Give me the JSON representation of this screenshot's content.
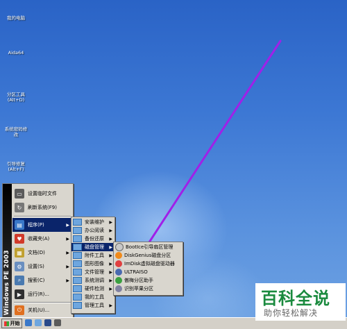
{
  "desktop": {
    "icons": [
      {
        "label": "我的电脑",
        "name": "my-computer-icon"
      },
      {
        "label": "Aida64",
        "name": "aida64-icon"
      },
      {
        "label": "分区工具\n(Alt+D)",
        "name": "partition-tool-icon"
      },
      {
        "label": "系统密码修\n改",
        "name": "password-tool-icon"
      },
      {
        "label": "引导修复\n(Alt+F)",
        "name": "boot-repair-icon"
      }
    ]
  },
  "start_menu": {
    "brand": "Windows PE 2003",
    "items": [
      {
        "label": "设置临时文件",
        "icon": "disk-icon",
        "color": "#5b5b5b"
      },
      {
        "label": "刷新系统(F9)",
        "icon": "refresh-icon",
        "color": "#777777"
      },
      {
        "label": "程序(P)",
        "icon": "folder-icon",
        "color": "#3a78c9",
        "arrow": "▶"
      },
      {
        "label": "收藏夹(A)",
        "icon": "heart-icon",
        "color": "#d23a2a",
        "arrow": "▶"
      },
      {
        "label": "文档(D)",
        "icon": "document-icon",
        "color": "#c0a030",
        "arrow": "▶"
      },
      {
        "label": "设置(S)",
        "icon": "settings-icon",
        "color": "#6a8fc0",
        "arrow": "▶"
      },
      {
        "label": "搜索(C)",
        "icon": "search-icon",
        "color": "#4a7ab0",
        "arrow": "▶"
      },
      {
        "label": "运行(R)...",
        "icon": "run-icon",
        "color": "#303030"
      },
      {
        "label": "关机(U)...",
        "icon": "power-icon",
        "color": "#e07020"
      }
    ]
  },
  "programs_menu": {
    "items": [
      {
        "label": "安装维护"
      },
      {
        "label": "办公阅读"
      },
      {
        "label": "备份还原"
      },
      {
        "label": "磁盘管理"
      },
      {
        "label": "附件工具"
      },
      {
        "label": "图形图像"
      },
      {
        "label": "文件管理"
      },
      {
        "label": "系统测调"
      },
      {
        "label": "硬件检测"
      },
      {
        "label": "我的工具"
      },
      {
        "label": "管理工具"
      }
    ]
  },
  "disk_menu": {
    "items": [
      {
        "label": "BootIce引导扇区管理",
        "color": "#c8c8c8"
      },
      {
        "label": "DiskGenius磁盘分区",
        "color": "#f08a1a"
      },
      {
        "label": "ImDisk虚拟磁盘驱动器",
        "color": "#e04040"
      },
      {
        "label": "ULTRAISO",
        "color": "#4a6ab0"
      },
      {
        "label": "傲梅分区助手",
        "color": "#3aa040"
      },
      {
        "label": "识别苹果分区",
        "color": "#8080a0"
      }
    ]
  },
  "taskbar": {
    "start_label": "开始"
  },
  "watermark": {
    "big": "百科全说",
    "small": "助你轻松解决"
  }
}
